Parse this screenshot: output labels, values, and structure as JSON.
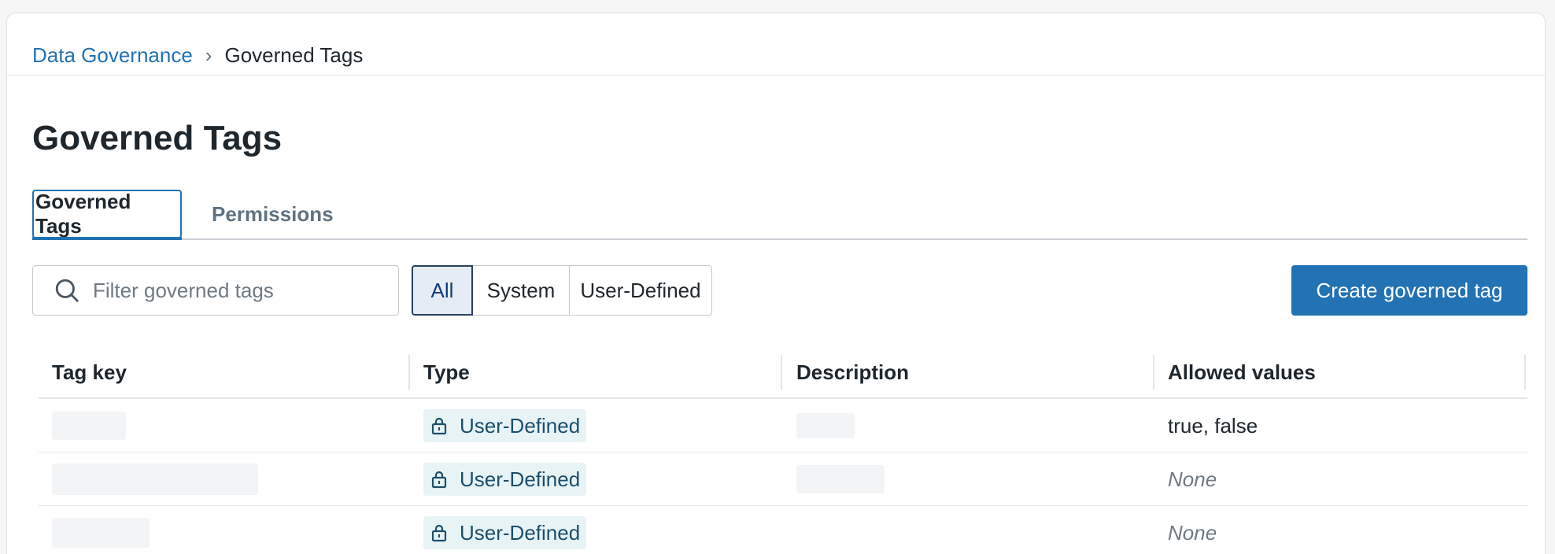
{
  "breadcrumb": {
    "parent": "Data Governance",
    "separator": "›",
    "current": "Governed Tags"
  },
  "page": {
    "title": "Governed Tags"
  },
  "tabs": [
    {
      "label": "Governed Tags",
      "active": true
    },
    {
      "label": "Permissions",
      "active": false
    }
  ],
  "search": {
    "placeholder": "Filter governed tags",
    "value": "",
    "icon": "search-icon"
  },
  "filters": [
    {
      "label": "All",
      "selected": true
    },
    {
      "label": "System",
      "selected": false
    },
    {
      "label": "User-Defined",
      "selected": false
    }
  ],
  "actions": {
    "create_label": "Create governed tag"
  },
  "table": {
    "columns": [
      "Tag key",
      "Type",
      "Description",
      "Allowed values"
    ],
    "rows": [
      {
        "type": "User-Defined",
        "allowed": "true, false"
      },
      {
        "type": "User-Defined",
        "allowed": "None"
      },
      {
        "type": "User-Defined",
        "allowed": "None"
      }
    ]
  },
  "colors": {
    "accent": "#2272b4",
    "badge_bg": "#e8f3f6",
    "badge_text": "#1c4f6b",
    "selected_filter_bg": "#e6ecf5"
  }
}
